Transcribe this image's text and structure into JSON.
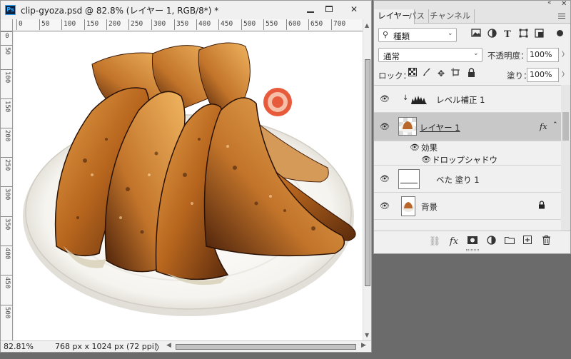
{
  "document": {
    "title": "clip-gyoza.psd @ 82.8% (レイヤー 1, RGB/8*) *",
    "app_icon_label": "Ps",
    "ruler_top_ticks": [
      "0",
      "50",
      "100",
      "150",
      "200",
      "250",
      "300",
      "350",
      "400",
      "450",
      "500",
      "550",
      "600",
      "650",
      "700"
    ],
    "ruler_left_ticks": [
      "0",
      "50",
      "100",
      "150",
      "200",
      "250",
      "300",
      "350",
      "400",
      "450",
      "500"
    ],
    "canvas_image": "gyoza-on-plate-image",
    "zoom": "82.81%",
    "doc_size": "768 px x 1024 px (72 ppi)",
    "status_arrow": "〉"
  },
  "window_controls": {
    "minimize": "minimize",
    "maximize": "maximize",
    "close": "✕"
  },
  "layers_panel": {
    "tabs": [
      {
        "label": "レイヤー",
        "active": true
      },
      {
        "label": "パス",
        "active": false
      },
      {
        "label": "チャンネル",
        "active": false
      }
    ],
    "filter_kind": "種類",
    "blend_mode": "通常",
    "opacity_label": "不透明度：",
    "opacity_value": "100%",
    "lock_label": "ロック：",
    "fill_label": "塗り：",
    "fill_value": "100%",
    "layers": [
      {
        "name": "レベル補正 1",
        "type": "adjustment"
      },
      {
        "name": "レイヤー 1",
        "type": "pixel",
        "selected": true,
        "fx": "fx"
      },
      {
        "name": "ベた 塗り 1",
        "type": "fill"
      },
      {
        "name": "背景",
        "type": "background",
        "locked": true
      }
    ],
    "effects": {
      "label": "効果",
      "items": [
        "ドロップシャドウ"
      ]
    },
    "colors": {
      "selected_row": "#c8c8c8",
      "panel_bg": "#f0f0f0",
      "workspace": "#6b6b6b"
    }
  }
}
